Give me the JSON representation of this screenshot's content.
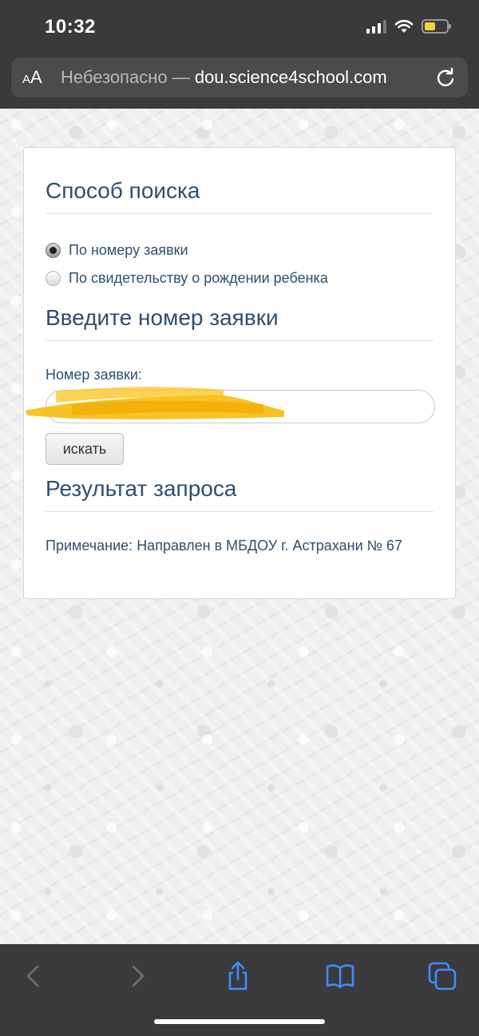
{
  "status_bar": {
    "time": "10:32"
  },
  "browser": {
    "text_size_button": "AA",
    "url_prefix": "Небезопасно — ",
    "url_domain": "dou.science4school.com"
  },
  "form": {
    "search_method_title": "Способ поиска",
    "search_options": [
      {
        "label": "По номеру заявки",
        "checked": true
      },
      {
        "label": "По свидетельству о рождении ребенка",
        "checked": false
      }
    ],
    "enter_number_title": "Введите номер заявки",
    "number_label": "Номер заявки:",
    "number_value": "",
    "search_button_label": "искать",
    "result_title": "Результат запроса",
    "result_note": "Примечание: Направлен в МБДОУ г. Астрахани № 67"
  },
  "colors": {
    "heading": "#2f4f6f",
    "chrome": "#3a3a3c",
    "ui_accent": "#4a90e2",
    "redaction": "#f5b400"
  },
  "icons": {
    "back": "chevron-left-icon",
    "forward": "chevron-right-icon",
    "share": "share-icon",
    "bookmarks": "book-icon",
    "tabs": "tabs-icon",
    "reload": "reload-icon"
  }
}
